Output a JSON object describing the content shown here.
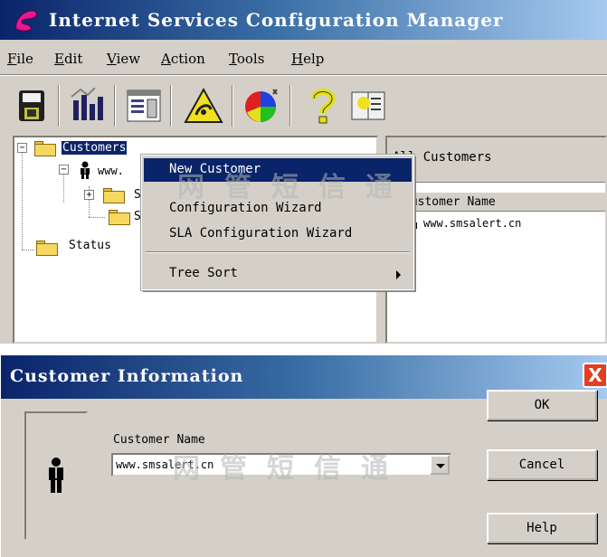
{
  "app": {
    "title": "Internet Services Configuration Manager",
    "menu": [
      "File",
      "Edit",
      "View",
      "Action",
      "Tools",
      "Help"
    ],
    "menu_underline": [
      "F",
      "E",
      "V",
      "A",
      "T",
      "H"
    ],
    "toolbar_icons": [
      "save-disk-icon",
      "chart-icon",
      "console-icon",
      "alert-icon",
      "pie-chart-icon",
      "help-question-icon",
      "book-icon"
    ]
  },
  "tree": {
    "root": "Customers",
    "customer": "www.",
    "child1": "S",
    "child2": "S",
    "status": "Status"
  },
  "right_pane": {
    "header": "All Customers",
    "column": "Customer Name",
    "row": "www.smsalert.cn"
  },
  "context_menu": {
    "items": [
      "New Customer",
      "Configuration Wizard",
      "SLA Configuration Wizard",
      "Tree Sort"
    ]
  },
  "watermark": "网管短信通",
  "dialog": {
    "title": "Customer Information",
    "label": "Customer Name",
    "value": "www.smsalert.cn",
    "ok": "OK",
    "cancel": "Cancel",
    "help": "Help",
    "close": "X"
  },
  "colors": {
    "title_bar": "#0a246a",
    "window_bg": "#d4d0c8",
    "close_red": "#e04020"
  }
}
